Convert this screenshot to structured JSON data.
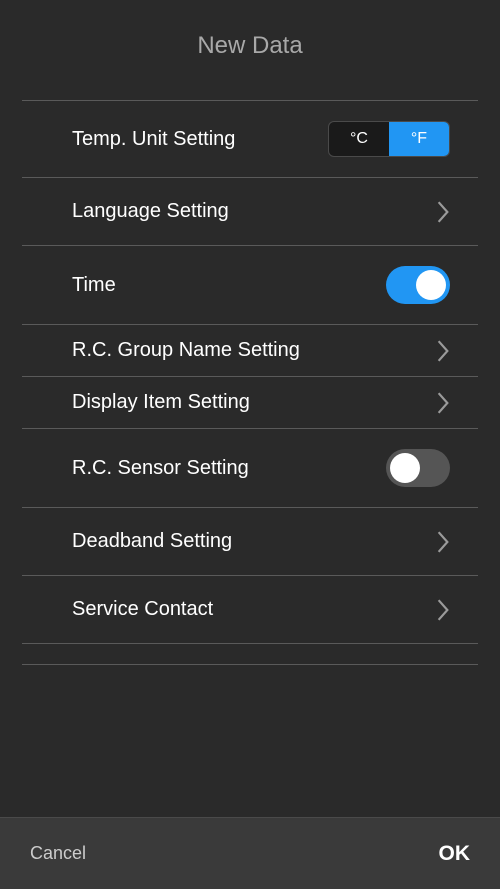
{
  "header": {
    "title": "New Data"
  },
  "rows": {
    "tempUnit": {
      "label": "Temp. Unit Setting",
      "optionC": "°C",
      "optionF": "°F",
      "selected": "F"
    },
    "language": {
      "label": "Language Setting"
    },
    "time": {
      "label": "Time",
      "enabled": true
    },
    "groupName": {
      "label": "R.C. Group Name Setting"
    },
    "displayItem": {
      "label": "Display Item Setting"
    },
    "sensor": {
      "label": "R.C. Sensor Setting",
      "enabled": false
    },
    "deadband": {
      "label": "Deadband Setting"
    },
    "serviceContact": {
      "label": "Service Contact"
    }
  },
  "footer": {
    "cancel": "Cancel",
    "ok": "OK"
  },
  "colors": {
    "accent": "#2196f3",
    "bg": "#2a2a2a",
    "footerBg": "#3a3a3a"
  }
}
